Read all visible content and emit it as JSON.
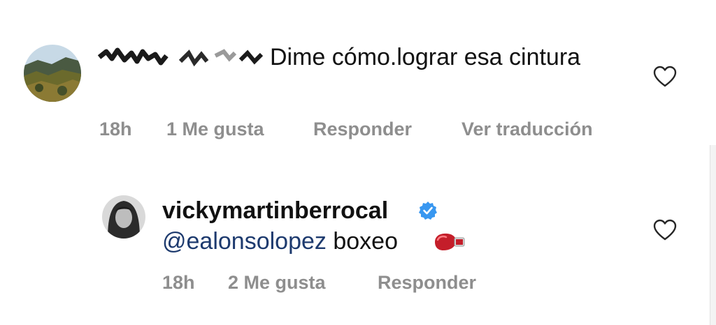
{
  "comments": [
    {
      "username": "",
      "text": "Dime cómo.lograr esa cintura",
      "time": "18h",
      "likes": "1 Me gusta",
      "reply": "Responder",
      "translate": "Ver traducción"
    },
    {
      "username": "vickymartinberrocal",
      "verified": true,
      "mention": "@ealonsolopez",
      "text": "boxeo",
      "emoji_icon": "boxing-glove-icon",
      "time": "18h",
      "likes": "2 Me gusta",
      "reply": "Responder"
    }
  ],
  "colors": {
    "meta": "#8e8e8e",
    "mention": "#1d3a6e",
    "verified": "#3897f0",
    "glove": "#c41e2a"
  }
}
